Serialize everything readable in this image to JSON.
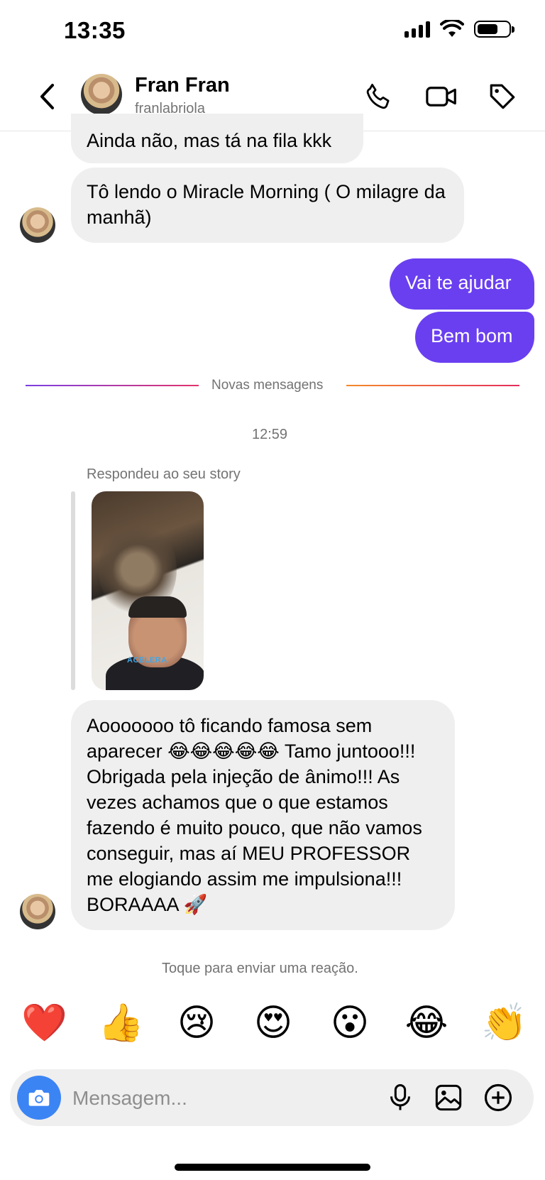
{
  "status_bar": {
    "time": "13:35"
  },
  "header": {
    "name": "Fran Fran",
    "username": "franlabriola",
    "icons": [
      "back-icon",
      "phone-icon",
      "video-icon",
      "tag-icon"
    ]
  },
  "messages": {
    "m1": "Ainda não, mas tá na fila kkk",
    "m2": "Tô lendo o Miracle Morning ( O milagre da manhã)",
    "out1": "Vai te ajudar",
    "out2": "Bem bom"
  },
  "divider": {
    "label": "Novas mensagens"
  },
  "timestamp": "12:59",
  "story_reply": {
    "label": "Respondeu ao seu story",
    "caption": "ACELERA"
  },
  "long_message": "Aooooooo tô ficando famosa sem aparecer 😂😂😂😂😂 Tamo juntooo!!! Obrigada pela injeção de ânimo!!! As vezes achamos que o que estamos fazendo é muito pouco, que não vamos conseguir, mas aí MEU PROFESSOR me elogiando assim me impulsiona!!! BORAAAA 🚀",
  "reaction_hint": "Toque para enviar uma reação.",
  "reactions": [
    "❤️",
    "👍",
    "😢",
    "😍",
    "😮",
    "😂",
    "👏"
  ],
  "composer": {
    "placeholder": "Mensagem..."
  },
  "colors": {
    "outgoing": "#6a3ff0",
    "incoming": "#efefef",
    "camera": "#3b84f4"
  }
}
